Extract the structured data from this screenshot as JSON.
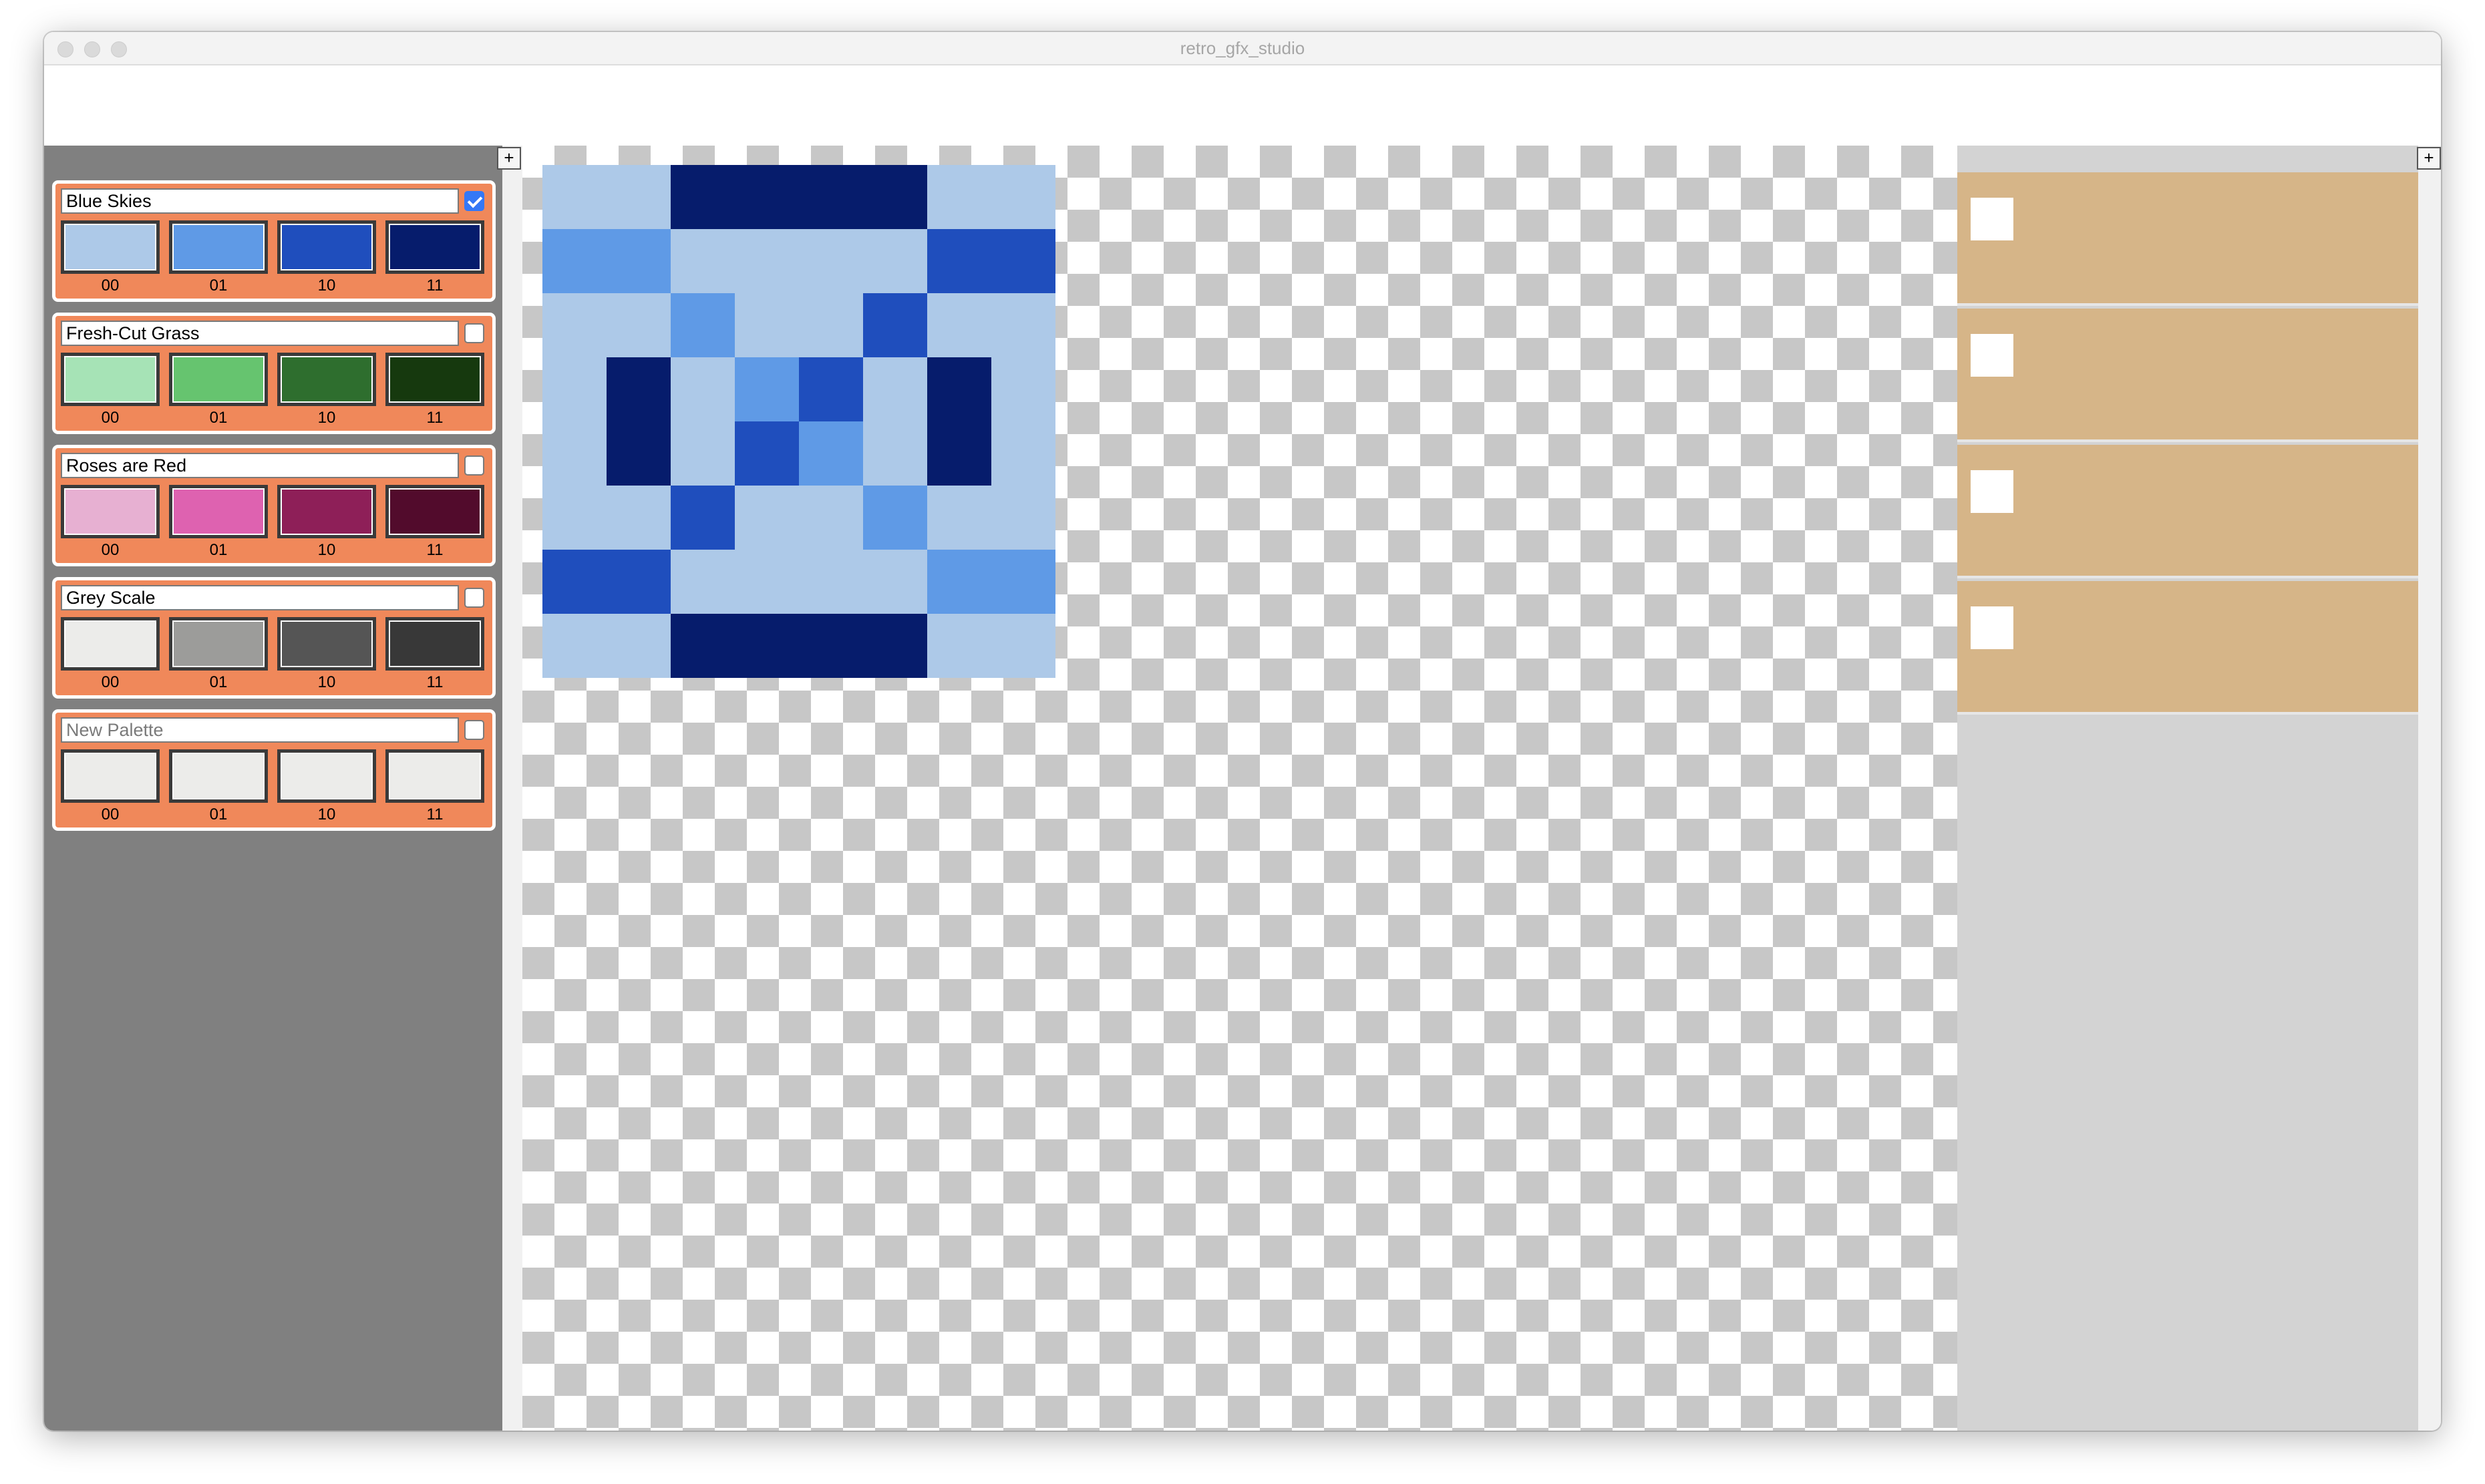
{
  "window": {
    "title": "retro_gfx_studio"
  },
  "palettes_panel": {
    "add_label": "+",
    "palettes": [
      {
        "name": "Blue Skies",
        "selected": true,
        "swatches": [
          {
            "label": "00",
            "color": "#adc9e8"
          },
          {
            "label": "01",
            "color": "#5f9ae6"
          },
          {
            "label": "10",
            "color": "#1f4ebd"
          },
          {
            "label": "11",
            "color": "#061c6c"
          }
        ]
      },
      {
        "name": "Fresh-Cut Grass",
        "selected": false,
        "swatches": [
          {
            "label": "00",
            "color": "#a6e3b6"
          },
          {
            "label": "01",
            "color": "#66c46f"
          },
          {
            "label": "10",
            "color": "#2e6e2e"
          },
          {
            "label": "11",
            "color": "#16390e"
          }
        ]
      },
      {
        "name": "Roses are Red",
        "selected": false,
        "swatches": [
          {
            "label": "00",
            "color": "#e7b0d2"
          },
          {
            "label": "01",
            "color": "#de62b0"
          },
          {
            "label": "10",
            "color": "#8e1f58"
          },
          {
            "label": "11",
            "color": "#520b2c"
          }
        ]
      },
      {
        "name": "Grey Scale",
        "selected": false,
        "swatches": [
          {
            "label": "00",
            "color": "#ececea"
          },
          {
            "label": "01",
            "color": "#9c9c9a"
          },
          {
            "label": "10",
            "color": "#555555"
          },
          {
            "label": "11",
            "color": "#383838"
          }
        ]
      },
      {
        "name": "",
        "placeholder": "New Palette",
        "selected": false,
        "swatches": [
          {
            "label": "00",
            "color": "#ececea"
          },
          {
            "label": "01",
            "color": "#ececea"
          },
          {
            "label": "10",
            "color": "#ececea"
          },
          {
            "label": "11",
            "color": "#ececea"
          }
        ]
      }
    ]
  },
  "canvas": {
    "palette_colors": [
      "#adc9e8",
      "#5f9ae6",
      "#1f4ebd",
      "#061c6c"
    ],
    "pixels": [
      [
        0,
        0,
        3,
        3,
        3,
        3,
        0,
        0
      ],
      [
        1,
        1,
        0,
        0,
        0,
        0,
        2,
        2
      ],
      [
        0,
        0,
        1,
        0,
        0,
        2,
        0,
        0
      ],
      [
        0,
        3,
        0,
        1,
        2,
        0,
        3,
        0
      ],
      [
        0,
        3,
        0,
        2,
        1,
        0,
        3,
        0
      ],
      [
        0,
        0,
        2,
        0,
        0,
        1,
        0,
        0
      ],
      [
        2,
        2,
        0,
        0,
        0,
        0,
        1,
        1
      ],
      [
        0,
        0,
        3,
        3,
        3,
        3,
        0,
        0
      ]
    ]
  },
  "tiles_panel": {
    "add_label": "+",
    "tile_count": 4
  }
}
